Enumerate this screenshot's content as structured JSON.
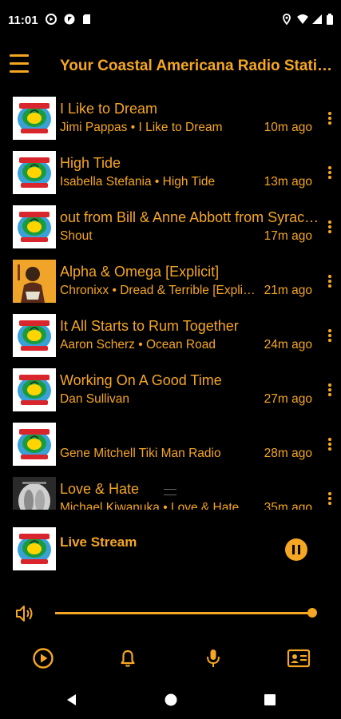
{
  "status_bar": {
    "time": "11:01",
    "left_icons": [
      "media-play-circle-icon",
      "nav-arrow-icon",
      "sd-card-icon"
    ],
    "right_icons": [
      "location-icon",
      "wifi-icon",
      "signal-icon",
      "battery-icon"
    ]
  },
  "app_bar": {
    "title": "Your Coastal Americana Radio Station",
    "menu_icon": "hamburger-menu-icon"
  },
  "tracks": [
    {
      "title": "I Like to Dream",
      "subtitle": "Jimi Pappas • I Like to Dream",
      "ago": "10m ago",
      "art": "station-logo"
    },
    {
      "title": "High Tide",
      "subtitle": "Isabella Stefania • High Tide",
      "ago": "13m ago",
      "art": "station-logo"
    },
    {
      "title": "out from Bill & Anne Abbott from Syracuse",
      "subtitle": "Shout",
      "ago": "17m ago",
      "art": "station-logo"
    },
    {
      "title": "Alpha & Omega [Explicit]",
      "subtitle": "Chronixx • Dread & Terrible [Explicit]",
      "ago": "21m ago",
      "art": "album-art"
    },
    {
      "title": "It All Starts to Rum Together",
      "subtitle": "Aaron Scherz • Ocean Road",
      "ago": "24m ago",
      "art": "station-logo"
    },
    {
      "title": "Working On A Good Time",
      "subtitle": "Dan Sullivan",
      "ago": "27m ago",
      "art": "station-logo"
    },
    {
      "title": "",
      "subtitle": "Gene Mitchell Tiki Man Radio",
      "ago": "28m ago",
      "art": "station-logo"
    },
    {
      "title": "Love & Hate",
      "subtitle": "Michael Kiwanuka • Love & Hate",
      "ago": "35m ago",
      "art": "grey-album-art"
    }
  ],
  "now_playing": {
    "title": "Live Stream",
    "pause_icon": "pause-icon"
  },
  "volume": {
    "icon": "volume-icon",
    "level": 1.0
  },
  "bottom_nav": [
    {
      "name": "play-circle-icon"
    },
    {
      "name": "bell-icon"
    },
    {
      "name": "microphone-icon"
    },
    {
      "name": "contact-card-icon"
    }
  ],
  "system_nav": [
    "back-icon",
    "home-icon",
    "recents-icon"
  ],
  "colors": {
    "accent": "#f5a623",
    "background": "#000000"
  }
}
